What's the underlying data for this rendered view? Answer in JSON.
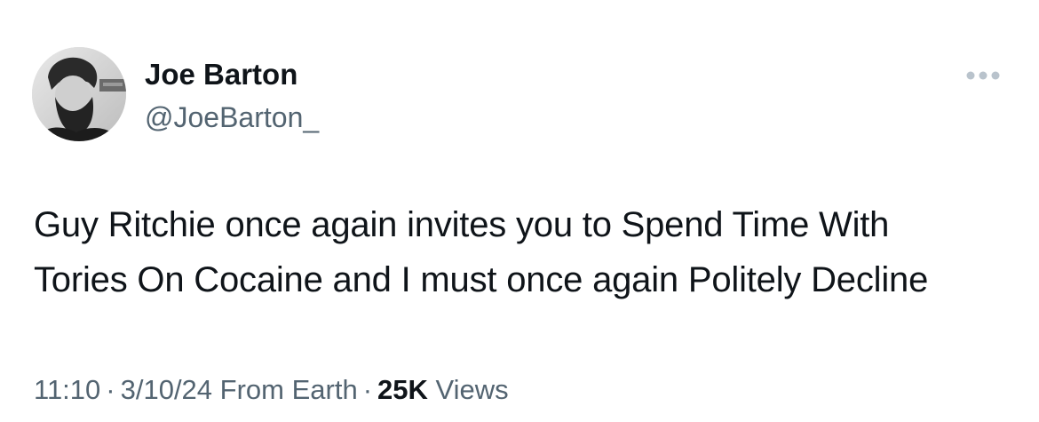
{
  "author": {
    "display_name": "Joe Barton",
    "handle": "@JoeBarton_"
  },
  "tweet": {
    "text_lines": [
      "Guy Ritchie once again invites you to Spend Time With",
      "Tories On Cocaine and I must once again Politely Decline"
    ]
  },
  "meta": {
    "time": "11:10",
    "separator": "·",
    "date": "3/10/24",
    "location": "From Earth",
    "views_count": "25K",
    "views_label": "Views"
  },
  "icons": {
    "more": "more-horizontal-icon"
  },
  "colors": {
    "primary_text": "#0f1419",
    "secondary_text": "#536471",
    "icon": "#b9c3cc",
    "background": "#ffffff"
  }
}
